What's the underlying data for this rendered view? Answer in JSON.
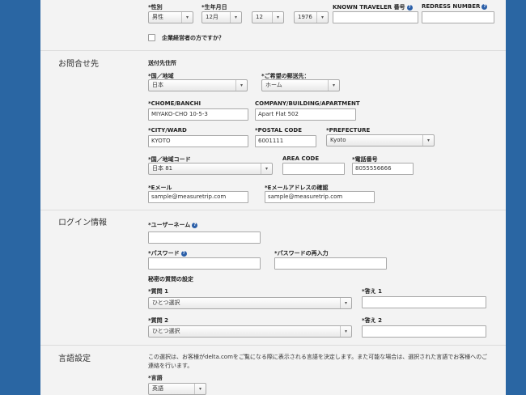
{
  "personal": {
    "gender_label": "*性別",
    "gender_value": "男性",
    "dob_label": "*生年月日",
    "dob_month": "12月",
    "dob_day": "12",
    "dob_year": "1976",
    "ktn_label": "KNOWN TRAVELER 番号",
    "redress_label": "REDRESS NUMBER",
    "business_question": "企業経営者の方ですか？"
  },
  "contact": {
    "section_title": "お問合せ先",
    "subsection_title": "送付先住所",
    "country_label": "*国／地域",
    "country_value": "日本",
    "mailing_label": "*ご希望の郵送先：",
    "mailing_value": "ホーム",
    "chome_label": "*CHOME/BANCHI",
    "chome_value": "MIYAKO-CHO 10-5-3",
    "company_label": "COMPANY/BUILDING/APARTMENT",
    "company_value": "Apart Flat 502",
    "city_label": "*CITY/WARD",
    "city_value": "KYOTO",
    "postal_label": "*POSTAL CODE",
    "postal_value": "6001111",
    "prefecture_label": "*PREFECTURE",
    "prefecture_value": "Kyoto",
    "country_code_label": "*国／地域コード",
    "country_code_value": "日本 81",
    "area_code_label": "AREA CODE",
    "phone_label": "*電話番号",
    "phone_value": "8055556666",
    "email_label": "*Eメール",
    "email_value": "sample@measuretrip.com",
    "email_confirm_label": "*Eメールアドレスの確認",
    "email_confirm_value": "sample@measuretrip.com"
  },
  "login": {
    "section_title": "ログイン情報",
    "username_label": "*ユーザーネーム",
    "password_label": "*パスワード",
    "password_confirm_label": "*パスワードの再入力",
    "security_title": "秘密の質問の設定",
    "q1_label": "*質問 1",
    "q1_value": "ひとつ選択",
    "a1_label": "*答え 1",
    "q2_label": "*質問 2",
    "q2_value": "ひとつ選択",
    "a2_label": "*答え 2"
  },
  "language": {
    "section_title": "言語設定",
    "description": "この選択は、お客様がdelta.comをご覧になる際に表示される言語を決定します。また可能な場合は、選択された言語でお客様へのご連絡を行います。",
    "language_label": "*言語",
    "language_value": "英語"
  },
  "icons": {
    "help": "?",
    "dropdown": "▾"
  },
  "colors": {
    "background": "#2a66a3",
    "panel": "#f3f3f3",
    "help_icon": "#2b5fa8"
  }
}
